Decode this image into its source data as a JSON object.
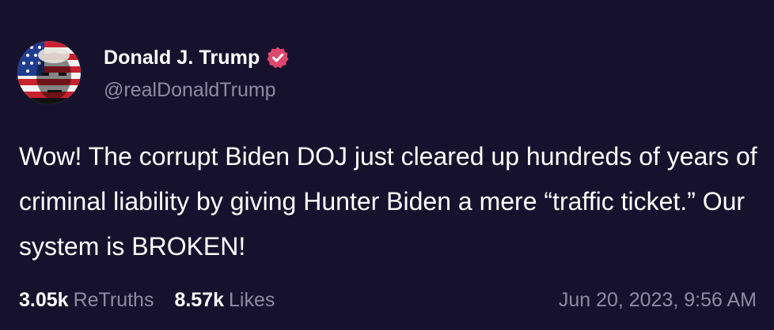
{
  "post": {
    "author": {
      "display_name": "Donald J. Trump",
      "handle": "@realDonaldTrump",
      "verified_icon": "verified-badge-icon",
      "verified_color": "#e0476c"
    },
    "text": "Wow! The corrupt Biden DOJ just cleared up hundreds of years of criminal liability by giving Hunter Biden a mere “traffic ticket.” Our system is BROKEN!",
    "stats": {
      "retruths_count": "3.05k",
      "retruths_label": "ReTruths",
      "likes_count": "8.57k",
      "likes_label": "Likes"
    },
    "timestamp": "Jun 20, 2023, 9:56 AM"
  },
  "colors": {
    "background": "#16122e",
    "primary_text": "#ffffff",
    "secondary_text": "#8e8ba3"
  }
}
